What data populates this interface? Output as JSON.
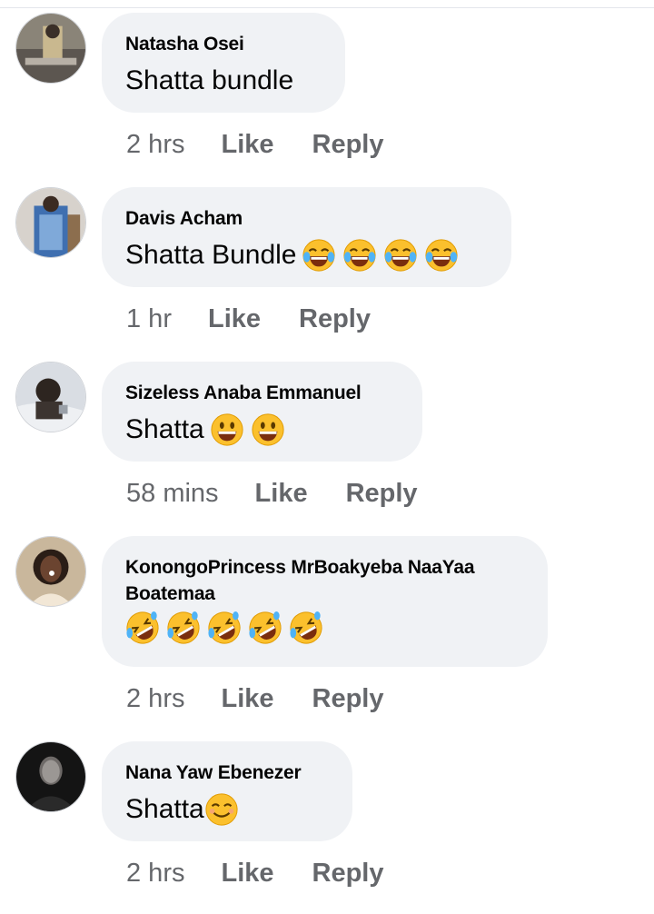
{
  "comments": [
    {
      "author": "Natasha Osei",
      "text": "Shatta bundle",
      "emojis": [],
      "time": "2 hrs",
      "like": "Like",
      "reply": "Reply"
    },
    {
      "author": "Davis Acham",
      "text": "Shatta Bundle",
      "emojis": [
        "tears-of-joy-emoji",
        "tears-of-joy-emoji",
        "tears-of-joy-emoji",
        "tears-of-joy-emoji"
      ],
      "time": "1 hr",
      "like": "Like",
      "reply": "Reply"
    },
    {
      "author": "Sizeless Anaba Emmanuel",
      "text": "Shatta",
      "emojis": [
        "grinning-face-emoji",
        "grinning-face-emoji"
      ],
      "time": "58 mins",
      "like": "Like",
      "reply": "Reply"
    },
    {
      "author": "KonongoPrincess MrBoakyeba NaaYaa Boatemaa",
      "text": "",
      "emojis": [
        "rolling-laughing-emoji",
        "rolling-laughing-emoji",
        "rolling-laughing-emoji",
        "rolling-laughing-emoji",
        "rolling-laughing-emoji"
      ],
      "time": "2 hrs",
      "like": "Like",
      "reply": "Reply"
    },
    {
      "author": "Nana Yaw Ebenezer",
      "text": "Shatta",
      "emojis": [
        "smiling-face-emoji"
      ],
      "time": "2 hrs",
      "like": "Like",
      "reply": "Reply"
    }
  ],
  "colors": {
    "bubble": "#f0f2f5",
    "meta": "#65676b",
    "emoji_face": "#fbc02d"
  }
}
